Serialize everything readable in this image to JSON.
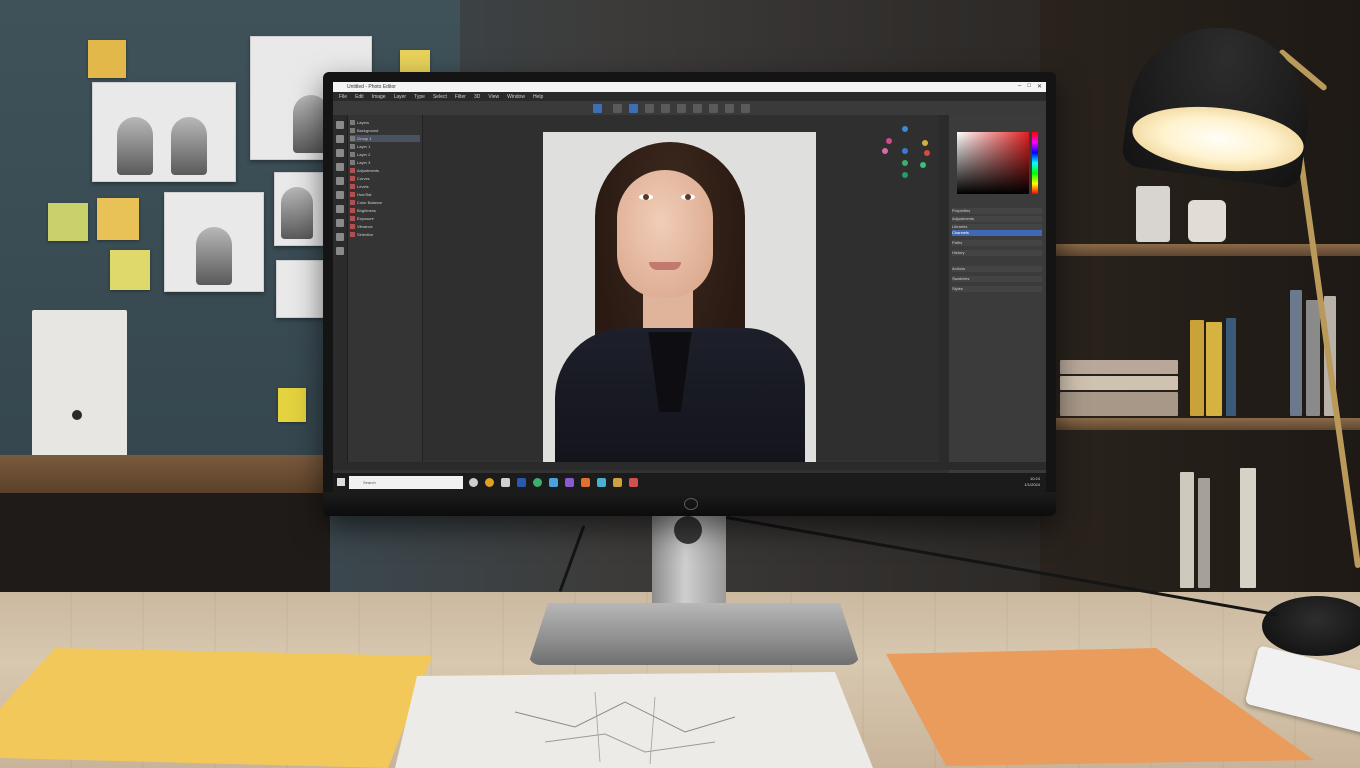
{
  "scene": {
    "photo_editor": {
      "titlebar": {
        "title": "Untitled - Photo Editor",
        "controls": [
          "–",
          "□",
          "✕"
        ]
      },
      "menubar": {
        "items": [
          "File",
          "Edit",
          "Image",
          "Layer",
          "Type",
          "Select",
          "Filter",
          "3D",
          "View",
          "Window",
          "Help"
        ]
      },
      "layers_left": {
        "rows": [
          "Layers",
          "Background",
          "Group 1",
          "Layer 1",
          "Layer 2",
          "Layer 3",
          "Adjustments",
          "Curves",
          "Levels",
          "Hue/Sat",
          "Color Balance",
          "Brightness",
          "Exposure",
          "Vibrance",
          "Selective"
        ],
        "selected_index": 2
      },
      "properties": {
        "rows": [
          "Properties",
          "Adjustments",
          "Libraries",
          "Channels",
          "Paths",
          "History",
          "Actions",
          "Swatches",
          "Styles"
        ],
        "highlight_index": 3
      },
      "taskbar": {
        "search_placeholder": "Search",
        "tray_time": "10:24",
        "tray_date": "1/1/2024"
      }
    }
  },
  "colors": {
    "accent_selection": "#3f6ab3",
    "screen_bg": "#323232",
    "taskbar": "#1b1b1b"
  }
}
